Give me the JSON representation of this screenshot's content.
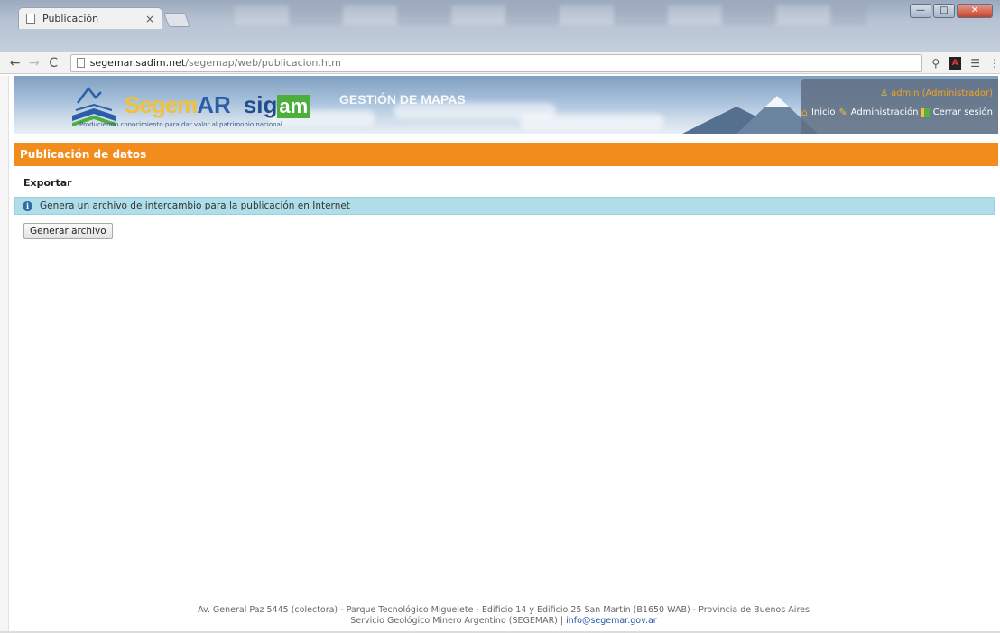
{
  "browser": {
    "tab_title": "Publicación",
    "tab_close": "×",
    "url_host": "segemar.sadim.net",
    "url_path": "/segemap/web/publicacion.htm",
    "back_glyph": "←",
    "forward_glyph": "→",
    "reload_glyph": "C",
    "menu_glyph": "⋮",
    "ext1_glyph": "⚲",
    "ext2_glyph": "⚲",
    "win_minimize": "—",
    "win_maximize": "□",
    "win_close": "✕"
  },
  "banner": {
    "logo_segem": "Segem",
    "logo_ar": "AR",
    "logo_sig": "sig",
    "logo_am": "am",
    "tagline": "Produciendo conocimiento para dar valor al patrimonio nacional",
    "title": "GESTIÓN DE MAPAS"
  },
  "user": {
    "name": "admin (Administrador)",
    "links": {
      "home": "Inicio",
      "admin": "Administración",
      "logout": "Cerrar sesión"
    }
  },
  "main": {
    "section_title": "Publicación de datos",
    "subheader": "Exportar",
    "info_text": "Genera un archivo de intercambio para la publicación en Internet",
    "info_icon": "i",
    "button_label": "Generar archivo"
  },
  "footer": {
    "line1": "Av. General Paz 5445 (colectora) - Parque Tecnológico Miguelete - Edificio 14 y Edificio 25 San Martín (B1650 WAB) - Provincia de Buenos Aires",
    "line2_prefix": "Servicio Geológico Minero Argentino (SEGEMAR) | ",
    "email": "info@segemar.gov.ar"
  },
  "colors": {
    "section_header": "#f28c1c",
    "info_bg": "#afdde9",
    "user_name": "#f7a31b"
  }
}
